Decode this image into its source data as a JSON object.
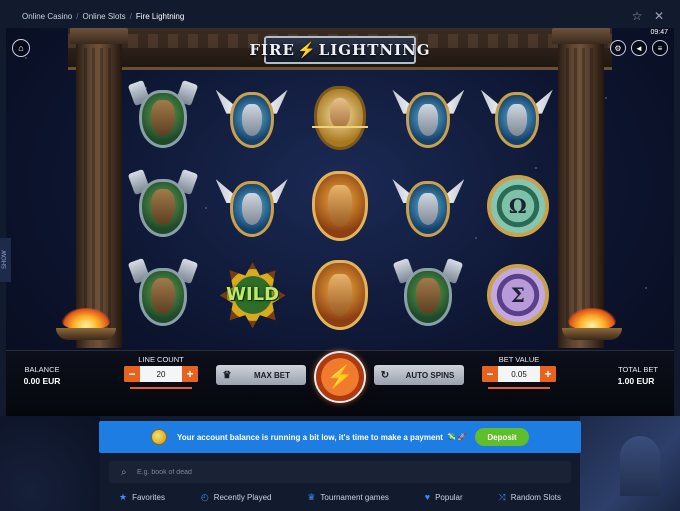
{
  "breadcrumb": {
    "items": [
      "Online Casino",
      "Online Slots"
    ],
    "current": "Fire Lightning"
  },
  "top_icons": [
    "star-icon",
    "close-icon"
  ],
  "game": {
    "title_left": "FIRE",
    "title_right": "LIGHTNING",
    "clock": "09:47",
    "show_tab": "SHOW",
    "reels": [
      [
        "warrior",
        "wing",
        "justice",
        "wing",
        "wing"
      ],
      [
        "warrior",
        "wing",
        "zeus",
        "wing",
        "omega"
      ],
      [
        "warrior",
        "wild",
        "zeus",
        "warrior",
        "sigma"
      ]
    ],
    "wild_text": "WILD",
    "omega_glyph": "Ω",
    "sigma_glyph": "Σ"
  },
  "controls": {
    "balance_label": "BALANCE",
    "balance_value": "0.00 EUR",
    "line_count_label": "LINE COUNT",
    "line_count_value": "20",
    "max_bet_label": "MAX BET",
    "auto_spins_label": "AUTO SPINS",
    "bet_value_label": "BET VALUE",
    "bet_value_value": "0.05",
    "total_bet_label": "TOTAL BET",
    "total_bet_value": "1.00 EUR",
    "minus": "−",
    "plus": "+"
  },
  "notice": {
    "message": "Your account balance is running a bit low, it's time to make a payment",
    "emoji": "💸 🚀",
    "deposit_label": "Deposit",
    "color": "#1d7de3"
  },
  "search": {
    "placeholder": "E.g. book of dead"
  },
  "tabs": [
    {
      "icon": "star-icon",
      "label": "Favorites"
    },
    {
      "icon": "history-icon",
      "label": "Recently Played"
    },
    {
      "icon": "trophy-icon",
      "label": "Tournament games"
    },
    {
      "icon": "heart-icon",
      "label": "Popular"
    },
    {
      "icon": "shuffle-icon",
      "label": "Random Slots"
    }
  ],
  "colors": {
    "accent_orange": "#e8621f",
    "deposit_green": "#5fbf2a",
    "tab_icon_blue": "#3d8df0"
  }
}
